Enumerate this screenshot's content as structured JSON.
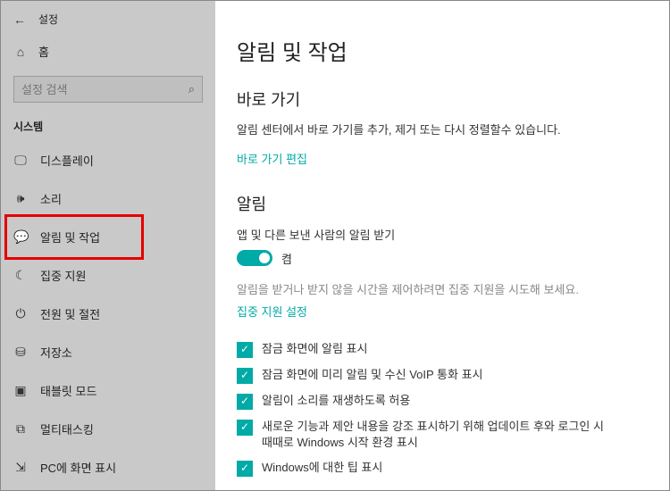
{
  "header": {
    "settings_title": "설정",
    "home_label": "홈"
  },
  "search": {
    "placeholder": "설정 검색"
  },
  "sidebar": {
    "section_label": "시스템",
    "items": [
      {
        "icon": "▭",
        "label": "디스플레이"
      },
      {
        "icon": "🔊",
        "label": "소리"
      },
      {
        "icon": "💬",
        "label": "알림 및 작업"
      },
      {
        "icon": "☾",
        "label": "집중 지원"
      },
      {
        "icon": "⏻",
        "label": "전원 및 절전"
      },
      {
        "icon": "▭",
        "label": "저장소"
      },
      {
        "icon": "▭",
        "label": "태블릿 모드"
      },
      {
        "icon": "⧉",
        "label": "멀티태스킹"
      },
      {
        "icon": "⇲",
        "label": "PC에 화면 표시"
      }
    ]
  },
  "content": {
    "page_title": "알림 및 작업",
    "quick_actions": {
      "title": "바로 가기",
      "desc": "알림 센터에서 바로 가기를 추가, 제거 또는 다시 정렬할수 있습니다.",
      "edit_link": "바로 가기 편집"
    },
    "notifications": {
      "title": "알림",
      "toggle_label": "앱 및 다른 보낸 사람의 알림 받기",
      "toggle_state": "켬",
      "note": "알림을 받거나 받지 않을 시간을 제어하려면 집중 지원을 시도해 보세요.",
      "focus_link": "집중 지원 설정",
      "checks": [
        "잠금 화면에 알림 표시",
        "잠금 화면에 미리 알림 및 수신 VoIP 통화 표시",
        "알림이 소리를 재생하도록 허용",
        "새로운 기능과 제안 내용을 강조 표시하기 위해 업데이트 후와 로그인 시 때때로 Windows 시작 환경 표시",
        "Windows에 대한 팁 표시"
      ]
    }
  }
}
